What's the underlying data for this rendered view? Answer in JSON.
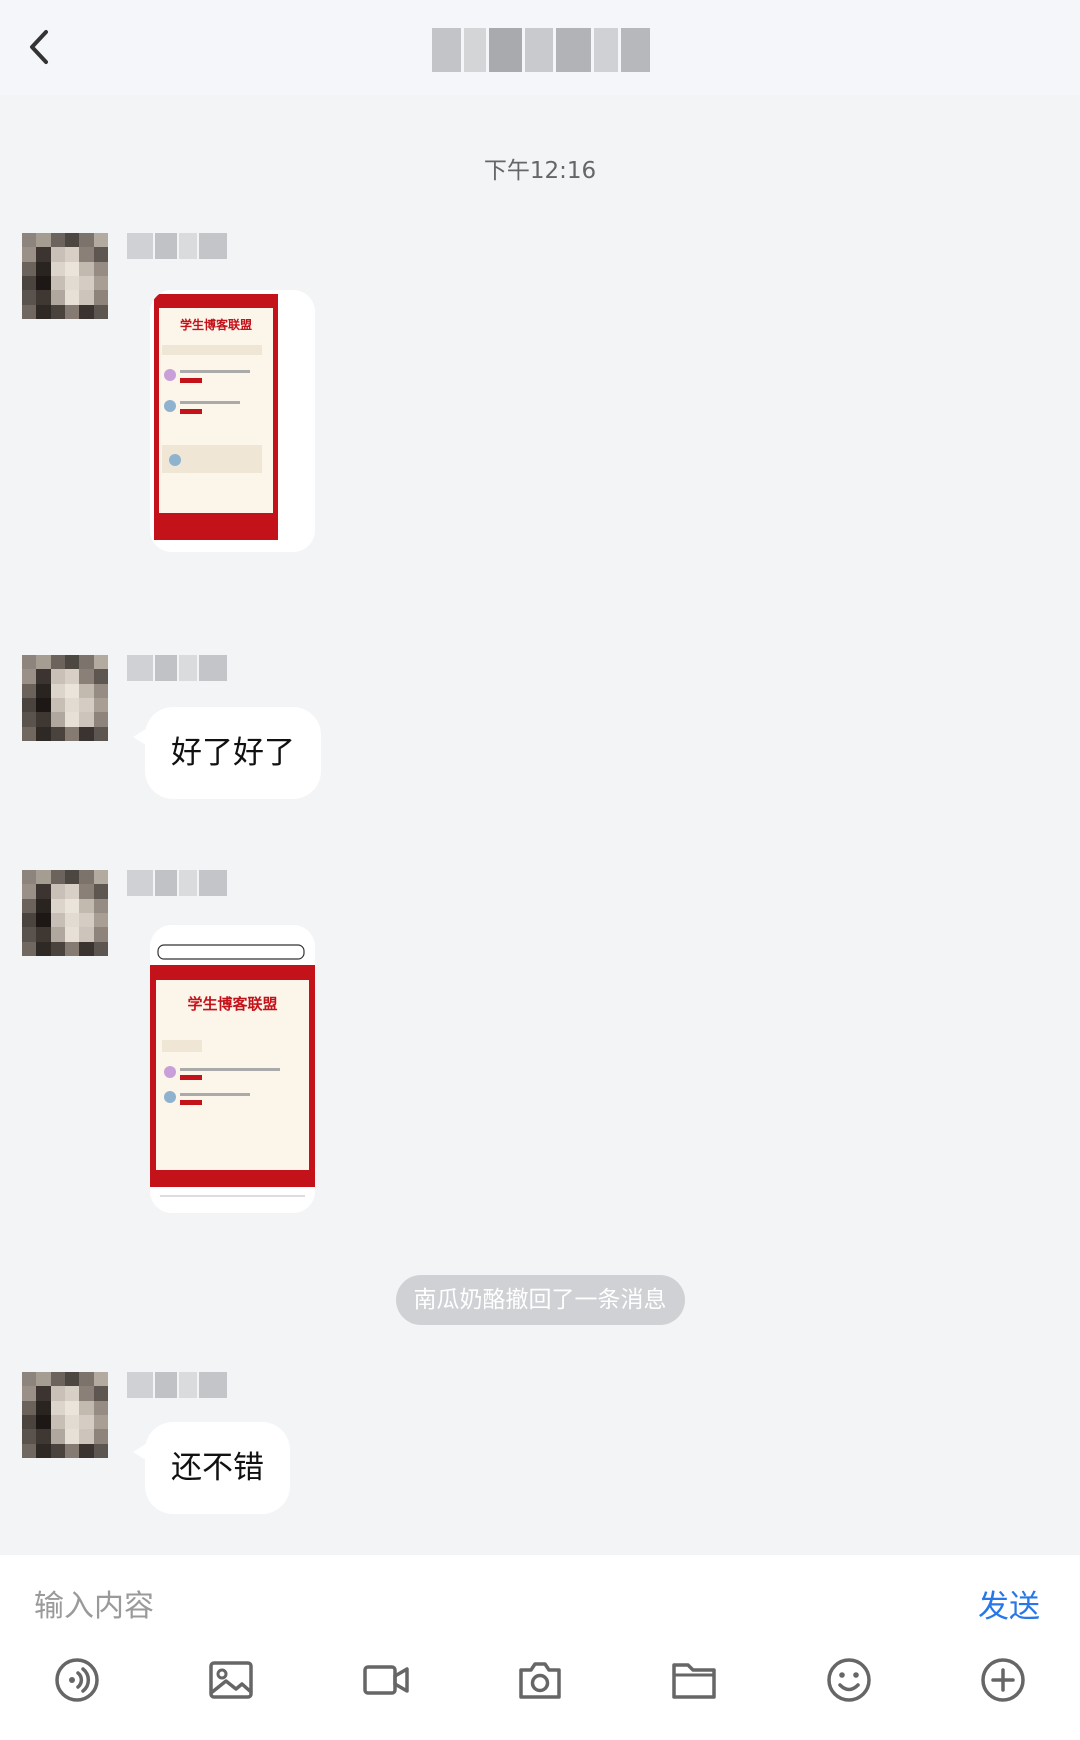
{
  "header": {
    "back_icon": "chevron-left-icon",
    "title_masked": true
  },
  "chat": {
    "timestamp": "下午12:16",
    "messages": [
      {
        "type": "image",
        "thumb_title": "学生博客联盟"
      },
      {
        "type": "text",
        "text": "好了好了"
      },
      {
        "type": "image",
        "thumb_title": "学生博客联盟"
      },
      {
        "type": "text",
        "text": "还不错"
      }
    ],
    "recall_notice": "南瓜奶酪撤回了一条消息"
  },
  "input": {
    "placeholder": "输入内容",
    "send_label": "发送"
  },
  "toolbar": {
    "icons": [
      "voice-icon",
      "image-icon",
      "video-icon",
      "camera-icon",
      "folder-icon",
      "emoji-icon",
      "plus-icon"
    ]
  },
  "colors": {
    "send": "#2777e8",
    "brand_red": "#c4121a",
    "bg": "#f3f4f6"
  }
}
